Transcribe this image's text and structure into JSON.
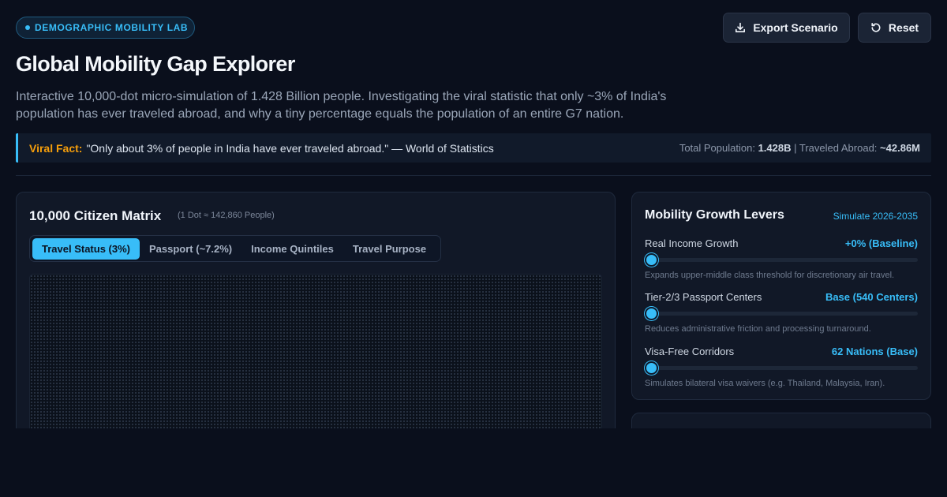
{
  "header": {
    "badge": "DEMOGRAPHIC MOBILITY LAB",
    "title": "Global Mobility Gap Explorer",
    "subtitle": "Interactive 10,000-dot micro-simulation of 1.428 Billion people. Investigating the viral statistic that only ~3% of India's population has ever traveled abroad, and why a tiny percentage equals the population of an entire G7 nation.",
    "export_label": "Export Scenario",
    "reset_label": "Reset"
  },
  "fact": {
    "label": "Viral Fact:",
    "text": "\"Only about 3% of people in India have ever traveled abroad.\" — World of Statistics",
    "population_label": "Total Population:",
    "population_value": "1.428B",
    "separator": "|",
    "traveled_label": "Traveled Abroad:",
    "traveled_value": "~42.86M"
  },
  "matrix": {
    "title": "10,000 Citizen Matrix",
    "note": "(1 Dot ≈ 142,860 People)",
    "tabs": [
      {
        "label": "Travel Status (3%)",
        "active": true
      },
      {
        "label": "Passport (~7.2%)",
        "active": false
      },
      {
        "label": "Income Quintiles",
        "active": false
      },
      {
        "label": "Travel Purpose",
        "active": false
      }
    ]
  },
  "levers": {
    "title": "Mobility Growth Levers",
    "link": "Simulate 2026-2035",
    "items": [
      {
        "name": "Real Income Growth",
        "value": "+0% (Baseline)",
        "desc": "Expands upper-middle class threshold for discretionary air travel.",
        "level": 0
      },
      {
        "name": "Tier-2/3 Passport Centers",
        "value": "Base (540 Centers)",
        "desc": "Reduces administrative friction and processing turnaround.",
        "level": 0
      },
      {
        "name": "Visa-Free Corridors",
        "value": "62 Nations (Base)",
        "desc": "Simulates bilateral visa waivers (e.g. Thailand, Malaysia, Iran).",
        "level": 0
      }
    ]
  },
  "colors": {
    "accent": "#38bdf8",
    "highlight": "#f59e0b",
    "background": "#0a0f1c",
    "panel": "#111827"
  }
}
